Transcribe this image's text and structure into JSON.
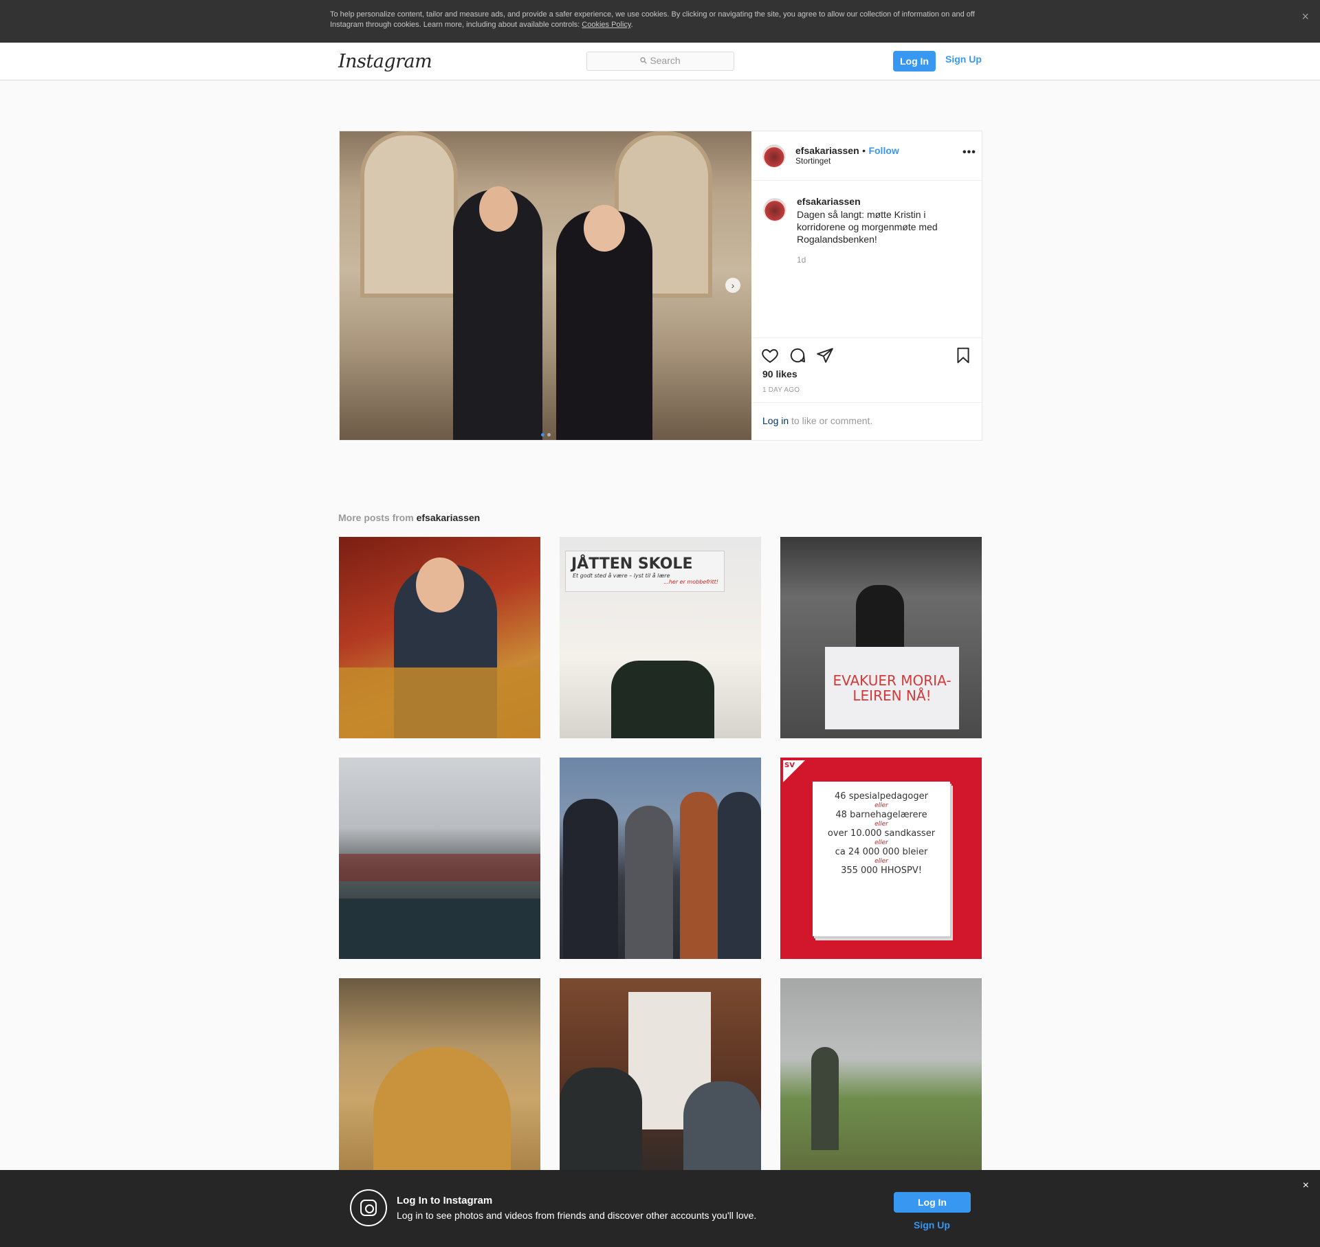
{
  "cookie_banner": {
    "text": "To help personalize content, tailor and measure ads, and provide a safer experience, we use cookies. By clicking or navigating the site, you agree to allow our collection of information on and off Instagram through cookies. Learn more, including about available controls: ",
    "link": "Cookies Policy",
    "close": "×"
  },
  "header": {
    "logo": "Instagram",
    "search_placeholder": "Search",
    "login": "Log In",
    "signup": "Sign Up"
  },
  "post": {
    "username": "efsakariassen",
    "separator": "•",
    "follow": "Follow",
    "location": "Stortinget",
    "more": "•••",
    "caption": "Dagen så langt: møtte Kristin i korridorene og morgenmøte med Rogalandsbenken!",
    "caption_time": "1d",
    "likes": "90 likes",
    "posted": "1 DAY AGO",
    "login_link": "Log in",
    "login_prompt": " to like or comment.",
    "carousel_index": 1,
    "carousel_total": 2
  },
  "more_posts": {
    "label": "More posts from ",
    "username": "efsakariassen",
    "tile2": {
      "title": "JÅTTEN SKOLE",
      "sub": "Et godt sted å være – lyst til å lære",
      "tag": "...her er mobbefritt!"
    },
    "tile3": {
      "banner": "EVAKUER MORIA-LEIREN NÅ!"
    },
    "tile6": {
      "badge": "SV",
      "lines": [
        "46 spesialpedagoger",
        "48 barnehagelærere",
        "over 10.000 sandkasser",
        "ca 24 000 000 bleier",
        "355 000 HHOSPV!"
      ],
      "or": "eller"
    }
  },
  "login_bar": {
    "title": "Log In to Instagram",
    "subtitle": "Log in to see photos and videos from friends and discover other accounts you'll love.",
    "login": "Log In",
    "signup": "Sign Up",
    "close": "×"
  },
  "colors": {
    "accent": "#3897f0",
    "banner_bg": "#333333",
    "loginbar_bg": "#262626"
  }
}
